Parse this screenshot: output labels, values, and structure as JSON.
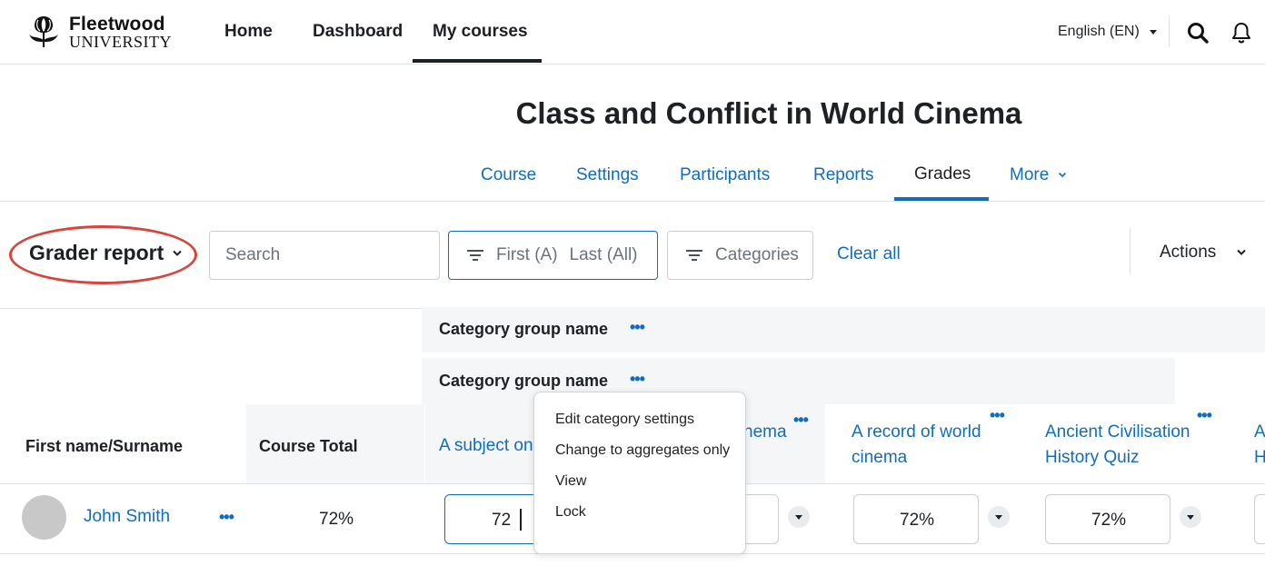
{
  "brand": {
    "name": "Fleetwood",
    "sub": "UNIVERSITY"
  },
  "topnav": {
    "items": [
      "Home",
      "Dashboard",
      "My courses"
    ],
    "active": "My courses"
  },
  "language": "English (EN)",
  "course": {
    "title": "Class and Conflict in World Cinema",
    "tabs": [
      "Course",
      "Settings",
      "Participants",
      "Reports",
      "Grades",
      "More"
    ],
    "active_tab": "Grades"
  },
  "toolbar": {
    "report_selector": "Grader report",
    "search_placeholder": "Search",
    "initials_filter": {
      "first": "First (A)",
      "last": "Last (All)"
    },
    "categories_label": "Categories",
    "clear_all": "Clear all",
    "actions": "Actions"
  },
  "grid": {
    "category_rows": [
      "Category group name",
      "Category group name"
    ],
    "col_name_header": "First name/Surname",
    "col_total_header": "Course Total",
    "grade_items": [
      "A subject on",
      "nema",
      "A record of world cinema",
      "Ancient Civilisation History Quiz",
      "A H"
    ],
    "rows": [
      {
        "name": "John Smith",
        "total": "72%",
        "grades": [
          "72",
          "",
          "72%",
          "72%"
        ]
      }
    ]
  },
  "context_menu": {
    "items": [
      "Edit category settings",
      "Change to aggregates only",
      "View",
      "Lock"
    ]
  },
  "colors": {
    "link": "#0f6cbf",
    "annotation": "#d9453a",
    "text": "#1d2125"
  }
}
